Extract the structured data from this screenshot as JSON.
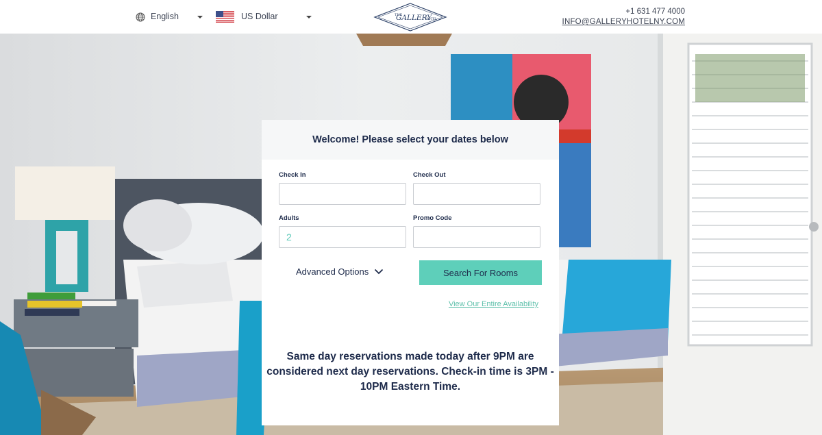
{
  "header": {
    "language": "English",
    "currency": "US Dollar",
    "logo_text_top": "THE",
    "logo_text_main": "GALLERY",
    "logo_text_side": "HOTEL",
    "phone": "+1 631 477 4000",
    "email": "INFO@GALLERYHOTELNY.COM"
  },
  "booking": {
    "title": "Welcome! Please select your dates below",
    "check_in_label": "Check In",
    "check_in_value": "",
    "check_out_label": "Check Out",
    "check_out_value": "",
    "adults_label": "Adults",
    "adults_value": "2",
    "promo_label": "Promo Code",
    "promo_value": "",
    "advanced_label": "Advanced Options",
    "search_label": "Search For Rooms",
    "availability_link": "View Our Entire Availability",
    "notice_lines": [
      "Same day reservations made today after 9PM are",
      "considered next day reservations. Check-in time is 3PM -",
      "10PM Eastern Time."
    ]
  },
  "colors": {
    "accent": "#5ecfba",
    "link": "#62c2ad",
    "text_dark": "#1d2a4a",
    "logo": "#2a3f66"
  },
  "icons": {
    "language": "globe-icon",
    "currency": "us-flag-icon",
    "dropdown": "caret-down-icon",
    "advanced": "chevron-down-icon"
  }
}
